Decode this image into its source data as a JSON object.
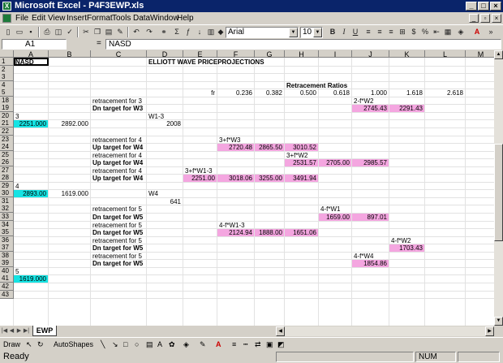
{
  "window": {
    "title": "Microsoft Excel - P4F3EWP.xls"
  },
  "menu": [
    "File",
    "Edit",
    "View",
    "Insert",
    "Format",
    "Tools",
    "Data",
    "Window",
    "Help"
  ],
  "toolbar": {
    "zoom": "",
    "font_name": "Arial",
    "font_size": "10"
  },
  "formula_bar": {
    "name_box": "A1",
    "equals": "=",
    "formula": "NASD"
  },
  "sheet": {
    "columns": [
      "A",
      "B",
      "C",
      "D",
      "E",
      "F",
      "G",
      "H",
      "I",
      "J",
      "K",
      "L",
      "M"
    ],
    "rows": [
      "1",
      "2",
      "3",
      "4",
      "5",
      "18",
      "19",
      "20",
      "21",
      "22",
      "23",
      "24",
      "25",
      "26",
      "27",
      "28",
      "29",
      "30",
      "31",
      "32",
      "33",
      "34",
      "35",
      "36",
      "37",
      "38",
      "39",
      "40",
      "41",
      "42",
      "43"
    ],
    "cells": [
      {
        "r": 0,
        "c": 0,
        "text": "NASD",
        "bold": true
      },
      {
        "r": 0,
        "c": 3,
        "text": "ELLIOTT WAVE PRICEPROJECTIONS",
        "bold": true
      },
      {
        "r": 3,
        "c": 7,
        "text": "Retracement Ratios",
        "bold": true
      },
      {
        "r": 4,
        "c": 4,
        "text": "fr",
        "align": "r"
      },
      {
        "r": 4,
        "c": 5,
        "text": "0.236",
        "align": "r"
      },
      {
        "r": 4,
        "c": 6,
        "text": "0.382",
        "align": "r"
      },
      {
        "r": 4,
        "c": 7,
        "text": "0.500",
        "align": "r"
      },
      {
        "r": 4,
        "c": 8,
        "text": "0.618",
        "align": "r"
      },
      {
        "r": 4,
        "c": 9,
        "text": "1.000",
        "align": "r"
      },
      {
        "r": 4,
        "c": 10,
        "text": "1.618",
        "align": "r"
      },
      {
        "r": 4,
        "c": 11,
        "text": "2.618",
        "align": "r"
      },
      {
        "r": 5,
        "c": 2,
        "text": "retracement for 3"
      },
      {
        "r": 5,
        "c": 9,
        "text": "2-f*W2"
      },
      {
        "r": 6,
        "c": 2,
        "text": "Dn target for W3",
        "bold": true
      },
      {
        "r": 6,
        "c": 9,
        "text": "2745.43",
        "align": "r",
        "fill": "pink"
      },
      {
        "r": 6,
        "c": 10,
        "text": "2291.43",
        "align": "r",
        "fill": "pink"
      },
      {
        "r": 7,
        "c": 0,
        "text": "3"
      },
      {
        "r": 7,
        "c": 3,
        "text": "W1-3"
      },
      {
        "r": 8,
        "c": 0,
        "text": "2251.000",
        "align": "r",
        "fill": "cyan"
      },
      {
        "r": 8,
        "c": 1,
        "text": "2892.000",
        "align": "r"
      },
      {
        "r": 8,
        "c": 3,
        "text": "2008",
        "align": "r"
      },
      {
        "r": 10,
        "c": 2,
        "text": "retracement for 4"
      },
      {
        "r": 10,
        "c": 5,
        "text": "3+f*W3"
      },
      {
        "r": 11,
        "c": 2,
        "text": "Up target for W4",
        "bold": true
      },
      {
        "r": 11,
        "c": 5,
        "text": "2720.48",
        "align": "r",
        "fill": "pink"
      },
      {
        "r": 11,
        "c": 6,
        "text": "2865.50",
        "align": "r",
        "fill": "pink"
      },
      {
        "r": 11,
        "c": 7,
        "text": "3010.52",
        "align": "r",
        "fill": "pink"
      },
      {
        "r": 12,
        "c": 2,
        "text": "retracement for 4"
      },
      {
        "r": 12,
        "c": 7,
        "text": "3+f*W2"
      },
      {
        "r": 13,
        "c": 2,
        "text": "Up target for W4",
        "bold": true
      },
      {
        "r": 13,
        "c": 7,
        "text": "2531.57",
        "align": "r",
        "fill": "pink"
      },
      {
        "r": 13,
        "c": 8,
        "text": "2705.00",
        "align": "r",
        "fill": "pink"
      },
      {
        "r": 13,
        "c": 9,
        "text": "2985.57",
        "align": "r",
        "fill": "pink"
      },
      {
        "r": 14,
        "c": 2,
        "text": "retracement for 4"
      },
      {
        "r": 14,
        "c": 4,
        "text": "3+f*W1-3"
      },
      {
        "r": 15,
        "c": 2,
        "text": "Up target for W4",
        "bold": true
      },
      {
        "r": 15,
        "c": 4,
        "text": "2251.00",
        "align": "r",
        "fill": "pink"
      },
      {
        "r": 15,
        "c": 5,
        "text": "3018.06",
        "align": "r",
        "fill": "pink"
      },
      {
        "r": 15,
        "c": 6,
        "text": "3255.00",
        "align": "r",
        "fill": "pink"
      },
      {
        "r": 15,
        "c": 7,
        "text": "3491.94",
        "align": "r",
        "fill": "pink"
      },
      {
        "r": 16,
        "c": 0,
        "text": "4"
      },
      {
        "r": 17,
        "c": 0,
        "text": "2893.00",
        "align": "r",
        "fill": "cyan"
      },
      {
        "r": 17,
        "c": 1,
        "text": "1619.000",
        "align": "r"
      },
      {
        "r": 17,
        "c": 3,
        "text": "W4"
      },
      {
        "r": 18,
        "c": 3,
        "text": "641",
        "align": "r"
      },
      {
        "r": 19,
        "c": 2,
        "text": "retracement for 5"
      },
      {
        "r": 19,
        "c": 8,
        "text": "4-f*W1"
      },
      {
        "r": 20,
        "c": 2,
        "text": "Dn target for W5",
        "bold": true
      },
      {
        "r": 20,
        "c": 8,
        "text": "1659.00",
        "align": "r",
        "fill": "pink"
      },
      {
        "r": 20,
        "c": 9,
        "text": "897.01",
        "align": "r",
        "fill": "pink"
      },
      {
        "r": 21,
        "c": 2,
        "text": "retracement for 5"
      },
      {
        "r": 21,
        "c": 5,
        "text": "4-f*W1-3"
      },
      {
        "r": 22,
        "c": 2,
        "text": "Dn target for W5",
        "bold": true
      },
      {
        "r": 22,
        "c": 5,
        "text": "2124.94",
        "align": "r",
        "fill": "pink"
      },
      {
        "r": 22,
        "c": 6,
        "text": "1888.00",
        "align": "r",
        "fill": "pink"
      },
      {
        "r": 22,
        "c": 7,
        "text": "1651.06",
        "align": "r",
        "fill": "pink"
      },
      {
        "r": 23,
        "c": 2,
        "text": "retracement for 5"
      },
      {
        "r": 23,
        "c": 10,
        "text": "4-f*W2"
      },
      {
        "r": 24,
        "c": 2,
        "text": "Dn target for W5",
        "bold": true
      },
      {
        "r": 24,
        "c": 10,
        "text": "1703.43",
        "align": "r",
        "fill": "pink"
      },
      {
        "r": 25,
        "c": 2,
        "text": "retracement for 5"
      },
      {
        "r": 25,
        "c": 9,
        "text": "4-f*W4"
      },
      {
        "r": 26,
        "c": 2,
        "text": "Dn target for W5",
        "bold": true
      },
      {
        "r": 26,
        "c": 9,
        "text": "1854.86",
        "align": "r",
        "fill": "pink"
      },
      {
        "r": 27,
        "c": 0,
        "text": "5"
      },
      {
        "r": 28,
        "c": 0,
        "text": "1619.000",
        "align": "r",
        "fill": "cyan"
      }
    ]
  },
  "tabs": {
    "sheet_tab": "EWP"
  },
  "drawing": {
    "draw": "Draw",
    "autoshapes": "AutoShapes"
  },
  "status": {
    "ready": "Ready",
    "num": "NUM"
  }
}
